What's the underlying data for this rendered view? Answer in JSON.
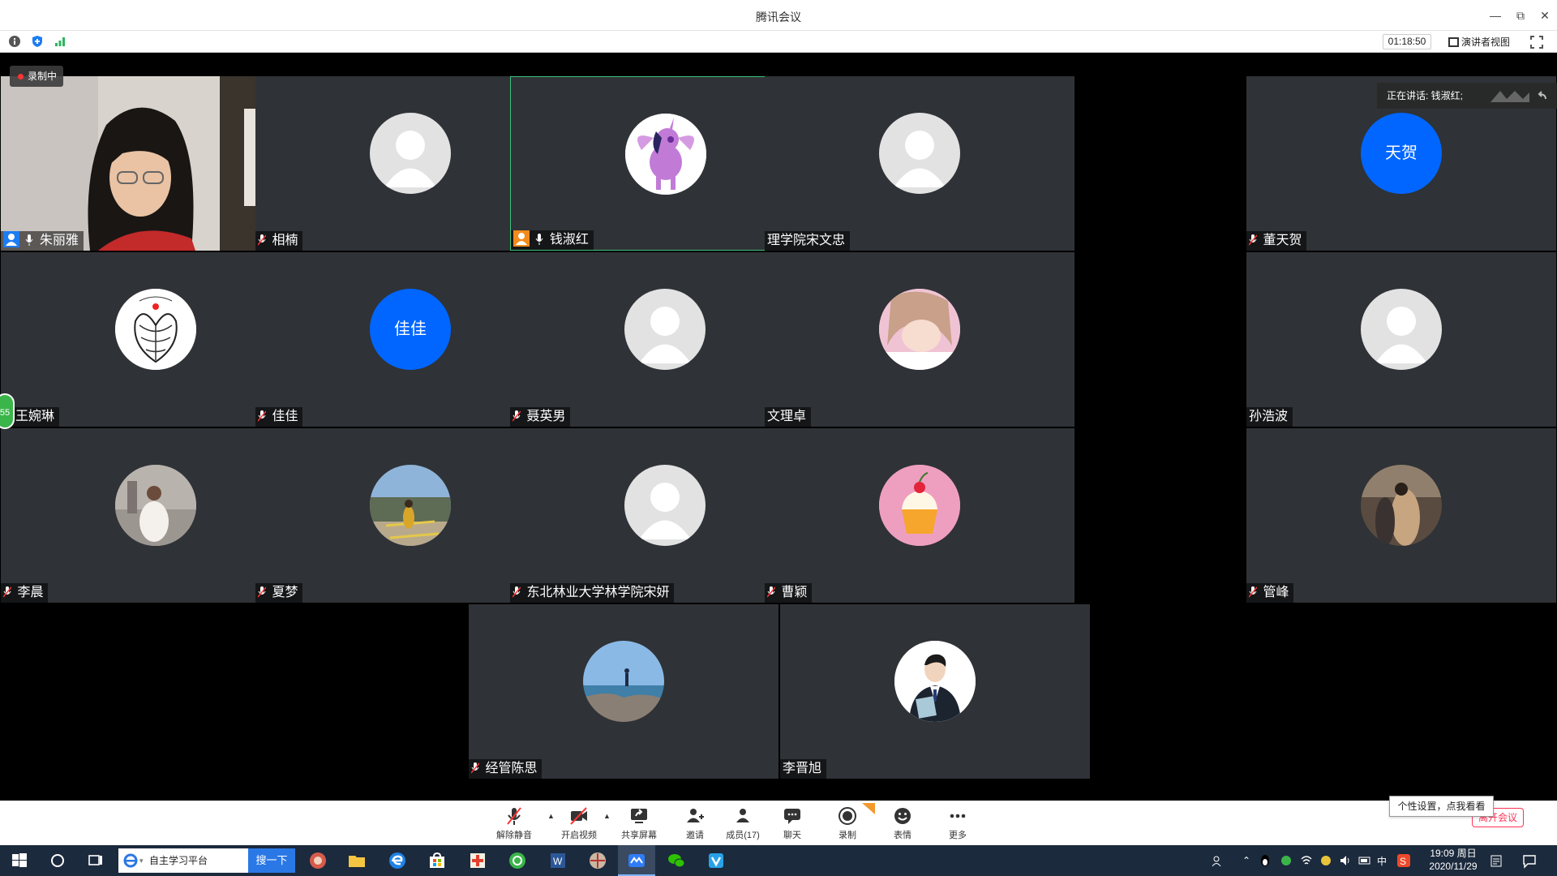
{
  "window": {
    "title": "腾讯会议"
  },
  "infobar": {
    "timer": "01:18:50",
    "speaker_view": "演讲者视图"
  },
  "overlay": {
    "recording": "录制中",
    "speaking": "正在讲话: 钱淑红;",
    "side_bubble": "55"
  },
  "participants": [
    {
      "name": "朱丽雅",
      "avatar": "video"
    },
    {
      "name": "相楠",
      "avatar": "default"
    },
    {
      "name": "钱淑红",
      "avatar": "pony"
    },
    {
      "name": "理学院宋文忠",
      "avatar": "default"
    },
    {
      "name": "董天贺",
      "avatar": "text",
      "avatar_text": "天贺"
    },
    {
      "name": "王婉琳",
      "avatar": "tree"
    },
    {
      "name": "佳佳",
      "avatar": "text",
      "avatar_text": "佳佳"
    },
    {
      "name": "聂英男",
      "avatar": "default"
    },
    {
      "name": "文理卓",
      "avatar": "girl"
    },
    {
      "name": "孙浩波",
      "avatar": "default"
    },
    {
      "name": "李晨",
      "avatar": "photo"
    },
    {
      "name": "夏梦",
      "avatar": "photo"
    },
    {
      "name": "东北林业大学林学院宋妍",
      "avatar": "default"
    },
    {
      "name": "曹颖",
      "avatar": "cupcake"
    },
    {
      "name": "管峰",
      "avatar": "photo"
    },
    {
      "name": "经管陈思",
      "avatar": "sea"
    },
    {
      "name": "李晋旭",
      "avatar": "suit"
    }
  ],
  "toolbar": {
    "unmute": "解除静音",
    "start_video": "开启视频",
    "share_screen": "共享屏幕",
    "invite": "邀请",
    "members": "成员(17)",
    "chat": "聊天",
    "record": "录制",
    "emoji": "表情",
    "more": "更多",
    "leave": "离开会议"
  },
  "tooltip": "个性设置，点我看看",
  "taskbar": {
    "search_text": "自主学习平台",
    "search_button": "搜一下",
    "ime": "中",
    "time": "19:09 周日",
    "date": "2020/11/29"
  }
}
